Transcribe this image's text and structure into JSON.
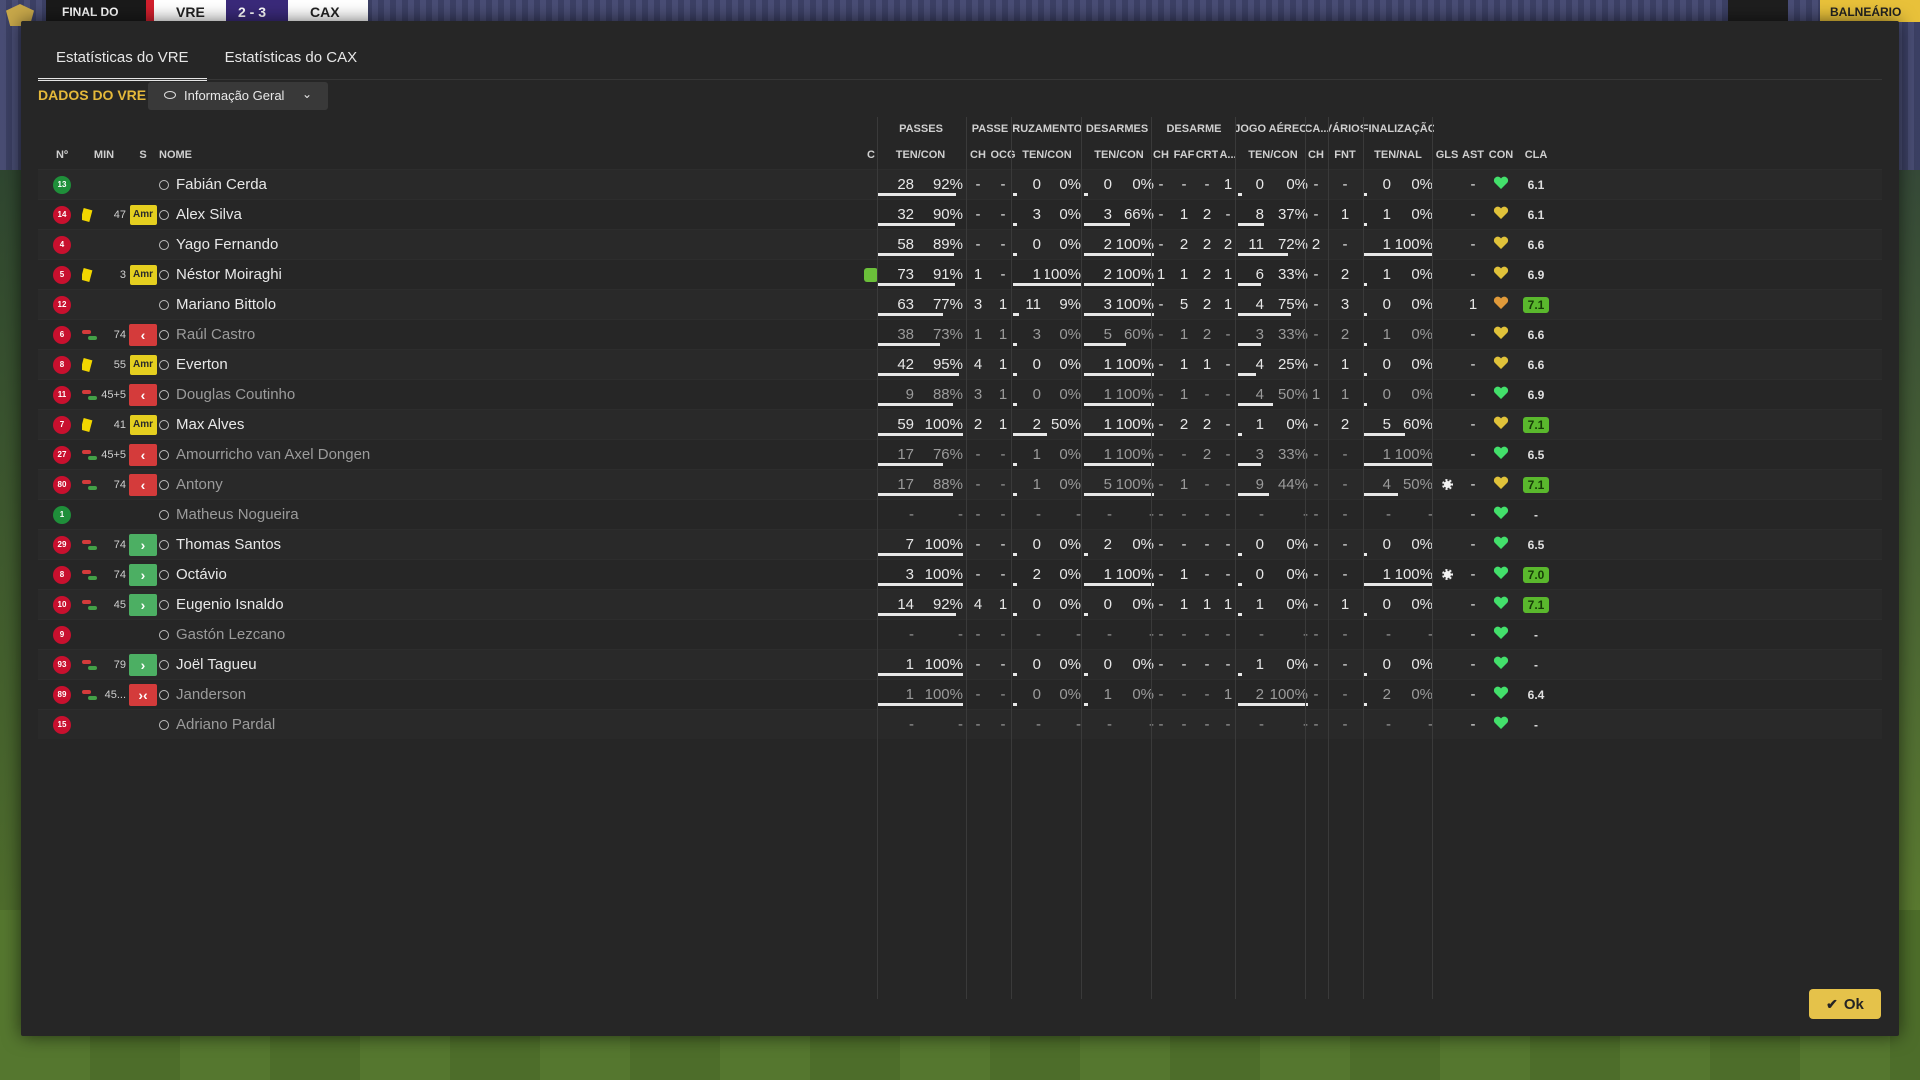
{
  "topbar": {
    "final_label": "FINAL DO",
    "home_team": "VRE",
    "score": "2 - 3",
    "away_team": "CAX",
    "balneario_label": "BALNEÁRIO"
  },
  "tabs": [
    {
      "label": "Estatísticas do VRE",
      "active": true
    },
    {
      "label": "Estatísticas do CAX",
      "active": false
    }
  ],
  "section_title": "DADOS DO VRE",
  "view_select": {
    "value": "Informação Geral"
  },
  "group_headers": {
    "passes": "PASSES",
    "passe": "PASSE",
    "cruzamentos": "CRUZAMENTOS",
    "desarmes": "DESARMES",
    "desarme": "DESARME",
    "jogo_aereo": "JOGO AÉREO",
    "ca": "CA...",
    "varios": "VÁRIOS",
    "finalizacao": "FINALIZAÇÃO"
  },
  "columns": {
    "no": "Nº",
    "min": "MIN",
    "s": "S",
    "nome": "NOME",
    "c": "C",
    "passes": "TEN/CON",
    "passe_ch": "CH",
    "passe_ocg": "OCG",
    "cruz": "TEN/CON",
    "desarmes": "TEN/CON",
    "des_ch": "CH",
    "des_faf": "FAF",
    "des_crt": "CRT",
    "des_a": "A...",
    "aereo": "TEN/CON",
    "ca_ch": "CH",
    "fnt": "FNT",
    "final": "TEN/NAL",
    "gls": "GLS",
    "ast": "AST",
    "con": "CON",
    "cla": "CLA"
  },
  "rows": [
    {
      "no": "13",
      "gk": true,
      "card": false,
      "sub": false,
      "min": "",
      "badge": "",
      "name": "Fabián Cerda",
      "dim": false,
      "c": "",
      "pas": [
        "28",
        "92%"
      ],
      "pch": "-",
      "pocg": "-",
      "cru": [
        "0",
        "0%"
      ],
      "des": [
        "0",
        "0%"
      ],
      "dch": "-",
      "dfaf": "-",
      "dcrt": "-",
      "da": "1",
      "aer": [
        "0",
        "0%"
      ],
      "cach": "-",
      "fnt": "-",
      "fin": [
        "0",
        "0%"
      ],
      "gls": "",
      "ast": "-",
      "con": "green",
      "cla": "6.1",
      "cla_good": false
    },
    {
      "no": "14",
      "gk": false,
      "card": true,
      "sub": false,
      "min": "47",
      "badge": "Amr",
      "name": "Alex Silva",
      "dim": false,
      "c": "",
      "pas": [
        "32",
        "90%"
      ],
      "pch": "-",
      "pocg": "-",
      "cru": [
        "3",
        "0%"
      ],
      "des": [
        "3",
        "66%"
      ],
      "dch": "-",
      "dfaf": "1",
      "dcrt": "2",
      "da": "-",
      "aer": [
        "8",
        "37%"
      ],
      "cach": "-",
      "fnt": "1",
      "fin": [
        "1",
        "0%"
      ],
      "gls": "",
      "ast": "-",
      "con": "yellow",
      "cla": "6.1",
      "cla_good": false
    },
    {
      "no": "4",
      "gk": false,
      "card": false,
      "sub": false,
      "min": "",
      "badge": "",
      "name": "Yago Fernando",
      "dim": false,
      "c": "",
      "pas": [
        "58",
        "89%"
      ],
      "pch": "-",
      "pocg": "-",
      "cru": [
        "0",
        "0%"
      ],
      "des": [
        "2",
        "100%"
      ],
      "dch": "-",
      "dfaf": "2",
      "dcrt": "2",
      "da": "2",
      "aer": [
        "11",
        "72%"
      ],
      "cach": "2",
      "fnt": "-",
      "fin": [
        "1",
        "100%"
      ],
      "gls": "",
      "ast": "-",
      "con": "yellow",
      "cla": "6.6",
      "cla_good": false
    },
    {
      "no": "5",
      "gk": false,
      "card": true,
      "sub": false,
      "min": "3",
      "badge": "Amr",
      "name": "Néstor Moiraghi",
      "dim": false,
      "c": "bottle",
      "pas": [
        "73",
        "91%"
      ],
      "pch": "1",
      "pocg": "-",
      "cru": [
        "1",
        "100%"
      ],
      "des": [
        "2",
        "100%"
      ],
      "dch": "1",
      "dfaf": "1",
      "dcrt": "2",
      "da": "1",
      "aer": [
        "6",
        "33%"
      ],
      "cach": "-",
      "fnt": "2",
      "fin": [
        "1",
        "0%"
      ],
      "gls": "",
      "ast": "-",
      "con": "yellow",
      "cla": "6.9",
      "cla_good": false
    },
    {
      "no": "12",
      "gk": false,
      "card": false,
      "sub": false,
      "min": "",
      "badge": "",
      "name": "Mariano Bittolo",
      "dim": false,
      "c": "",
      "pas": [
        "63",
        "77%"
      ],
      "pch": "3",
      "pocg": "1",
      "cru": [
        "11",
        "9%"
      ],
      "des": [
        "3",
        "100%"
      ],
      "dch": "-",
      "dfaf": "5",
      "dcrt": "2",
      "da": "1",
      "aer": [
        "4",
        "75%"
      ],
      "cach": "-",
      "fnt": "3",
      "fin": [
        "0",
        "0%"
      ],
      "gls": "",
      "ast": "1",
      "con": "orange",
      "cla": "7.1",
      "cla_good": true
    },
    {
      "no": "6",
      "gk": false,
      "card": false,
      "sub": true,
      "min": "74",
      "badge": "out",
      "name": "Raúl Castro",
      "dim": true,
      "c": "",
      "pas": [
        "38",
        "73%"
      ],
      "pch": "1",
      "pocg": "1",
      "cru": [
        "3",
        "0%"
      ],
      "des": [
        "5",
        "60%"
      ],
      "dch": "-",
      "dfaf": "1",
      "dcrt": "2",
      "da": "-",
      "aer": [
        "3",
        "33%"
      ],
      "cach": "-",
      "fnt": "2",
      "fin": [
        "1",
        "0%"
      ],
      "gls": "",
      "ast": "-",
      "con": "yellow",
      "cla": "6.6",
      "cla_good": false
    },
    {
      "no": "8",
      "gk": false,
      "card": true,
      "sub": false,
      "min": "55",
      "badge": "Amr",
      "name": "Everton",
      "dim": false,
      "c": "",
      "pas": [
        "42",
        "95%"
      ],
      "pch": "4",
      "pocg": "1",
      "cru": [
        "0",
        "0%"
      ],
      "des": [
        "1",
        "100%"
      ],
      "dch": "-",
      "dfaf": "1",
      "dcrt": "1",
      "da": "-",
      "aer": [
        "4",
        "25%"
      ],
      "cach": "-",
      "fnt": "1",
      "fin": [
        "0",
        "0%"
      ],
      "gls": "",
      "ast": "-",
      "con": "yellow",
      "cla": "6.6",
      "cla_good": false
    },
    {
      "no": "11",
      "gk": false,
      "card": false,
      "sub": true,
      "min": "45+5",
      "badge": "out",
      "name": "Douglas Coutinho",
      "dim": true,
      "c": "",
      "pas": [
        "9",
        "88%"
      ],
      "pch": "3",
      "pocg": "1",
      "cru": [
        "0",
        "0%"
      ],
      "des": [
        "1",
        "100%"
      ],
      "dch": "-",
      "dfaf": "1",
      "dcrt": "-",
      "da": "-",
      "aer": [
        "4",
        "50%"
      ],
      "cach": "1",
      "fnt": "1",
      "fin": [
        "0",
        "0%"
      ],
      "gls": "",
      "ast": "-",
      "con": "green",
      "cla": "6.9",
      "cla_good": false
    },
    {
      "no": "7",
      "gk": false,
      "card": true,
      "sub": false,
      "min": "41",
      "badge": "Amr",
      "name": "Max Alves",
      "dim": false,
      "c": "",
      "pas": [
        "59",
        "100%"
      ],
      "pch": "2",
      "pocg": "1",
      "cru": [
        "2",
        "50%"
      ],
      "des": [
        "1",
        "100%"
      ],
      "dch": "-",
      "dfaf": "2",
      "dcrt": "2",
      "da": "-",
      "aer": [
        "1",
        "0%"
      ],
      "cach": "-",
      "fnt": "2",
      "fin": [
        "5",
        "60%"
      ],
      "gls": "",
      "ast": "-",
      "con": "yellow",
      "cla": "7.1",
      "cla_good": true
    },
    {
      "no": "27",
      "gk": false,
      "card": false,
      "sub": true,
      "min": "45+5",
      "badge": "out",
      "name": "Amourricho van Axel Dongen",
      "dim": true,
      "c": "",
      "pas": [
        "17",
        "76%"
      ],
      "pch": "-",
      "pocg": "-",
      "cru": [
        "1",
        "0%"
      ],
      "des": [
        "1",
        "100%"
      ],
      "dch": "-",
      "dfaf": "-",
      "dcrt": "2",
      "da": "-",
      "aer": [
        "3",
        "33%"
      ],
      "cach": "-",
      "fnt": "-",
      "fin": [
        "1",
        "100%"
      ],
      "gls": "",
      "ast": "-",
      "con": "green",
      "cla": "6.5",
      "cla_good": false
    },
    {
      "no": "80",
      "gk": false,
      "card": false,
      "sub": true,
      "min": "74",
      "badge": "out",
      "name": "Antony",
      "dim": true,
      "c": "",
      "pas": [
        "17",
        "88%"
      ],
      "pch": "-",
      "pocg": "-",
      "cru": [
        "1",
        "0%"
      ],
      "des": [
        "5",
        "100%"
      ],
      "dch": "-",
      "dfaf": "1",
      "dcrt": "-",
      "da": "-",
      "aer": [
        "9",
        "44%"
      ],
      "cach": "-",
      "fnt": "-",
      "fin": [
        "4",
        "50%"
      ],
      "gls": "ball",
      "ast": "-",
      "con": "yellow",
      "cla": "7.1",
      "cla_good": true
    },
    {
      "no": "1",
      "gk": true,
      "card": false,
      "sub": false,
      "min": "",
      "badge": "",
      "name": "Matheus Nogueira",
      "dim": true,
      "c": "",
      "pas": [
        "-",
        "-"
      ],
      "pch": "-",
      "pocg": "-",
      "cru": [
        "-",
        "-"
      ],
      "des": [
        "-",
        "-"
      ],
      "dch": "-",
      "dfaf": "-",
      "dcrt": "-",
      "da": "-",
      "aer": [
        "-",
        "-"
      ],
      "cach": "-",
      "fnt": "-",
      "fin": [
        "-",
        "-"
      ],
      "gls": "",
      "ast": "-",
      "con": "green",
      "cla": "-",
      "cla_good": false
    },
    {
      "no": "29",
      "gk": false,
      "card": false,
      "sub": true,
      "min": "74",
      "badge": "in",
      "name": "Thomas Santos",
      "dim": false,
      "c": "",
      "pas": [
        "7",
        "100%"
      ],
      "pch": "-",
      "pocg": "-",
      "cru": [
        "0",
        "0%"
      ],
      "des": [
        "2",
        "0%"
      ],
      "dch": "-",
      "dfaf": "-",
      "dcrt": "-",
      "da": "-",
      "aer": [
        "0",
        "0%"
      ],
      "cach": "-",
      "fnt": "-",
      "fin": [
        "0",
        "0%"
      ],
      "gls": "",
      "ast": "-",
      "con": "green",
      "cla": "6.5",
      "cla_good": false
    },
    {
      "no": "8",
      "gk": false,
      "card": false,
      "sub": true,
      "min": "74",
      "badge": "in",
      "name": "Octávio",
      "dim": false,
      "c": "",
      "pas": [
        "3",
        "100%"
      ],
      "pch": "-",
      "pocg": "-",
      "cru": [
        "2",
        "0%"
      ],
      "des": [
        "1",
        "100%"
      ],
      "dch": "-",
      "dfaf": "1",
      "dcrt": "-",
      "da": "-",
      "aer": [
        "0",
        "0%"
      ],
      "cach": "-",
      "fnt": "-",
      "fin": [
        "1",
        "100%"
      ],
      "gls": "ball",
      "ast": "-",
      "con": "green",
      "cla": "7.0",
      "cla_good": true
    },
    {
      "no": "10",
      "gk": false,
      "card": false,
      "sub": true,
      "min": "45",
      "badge": "in",
      "name": "Eugenio Isnaldo",
      "dim": false,
      "c": "",
      "pas": [
        "14",
        "92%"
      ],
      "pch": "4",
      "pocg": "1",
      "cru": [
        "0",
        "0%"
      ],
      "des": [
        "0",
        "0%"
      ],
      "dch": "-",
      "dfaf": "1",
      "dcrt": "1",
      "da": "1",
      "aer": [
        "1",
        "0%"
      ],
      "cach": "-",
      "fnt": "1",
      "fin": [
        "0",
        "0%"
      ],
      "gls": "",
      "ast": "-",
      "con": "green",
      "cla": "7.1",
      "cla_good": true
    },
    {
      "no": "9",
      "gk": false,
      "card": false,
      "sub": false,
      "min": "",
      "badge": "",
      "name": "Gastón Lezcano",
      "dim": true,
      "c": "",
      "pas": [
        "-",
        "-"
      ],
      "pch": "-",
      "pocg": "-",
      "cru": [
        "-",
        "-"
      ],
      "des": [
        "-",
        "-"
      ],
      "dch": "-",
      "dfaf": "-",
      "dcrt": "-",
      "da": "-",
      "aer": [
        "-",
        "-"
      ],
      "cach": "-",
      "fnt": "-",
      "fin": [
        "-",
        "-"
      ],
      "gls": "",
      "ast": "-",
      "con": "green",
      "cla": "-",
      "cla_good": false
    },
    {
      "no": "93",
      "gk": false,
      "card": false,
      "sub": true,
      "min": "79",
      "badge": "in",
      "name": "Joël Tagueu",
      "dim": false,
      "c": "",
      "pas": [
        "1",
        "100%"
      ],
      "pch": "-",
      "pocg": "-",
      "cru": [
        "0",
        "0%"
      ],
      "des": [
        "0",
        "0%"
      ],
      "dch": "-",
      "dfaf": "-",
      "dcrt": "-",
      "da": "-",
      "aer": [
        "1",
        "0%"
      ],
      "cach": "-",
      "fnt": "-",
      "fin": [
        "0",
        "0%"
      ],
      "gls": "",
      "ast": "-",
      "con": "green",
      "cla": "-",
      "cla_good": false
    },
    {
      "no": "89",
      "gk": false,
      "card": false,
      "sub": true,
      "min": "45...",
      "badge": "inout",
      "name": "Janderson",
      "dim": true,
      "c": "",
      "pas": [
        "1",
        "100%"
      ],
      "pch": "-",
      "pocg": "-",
      "cru": [
        "0",
        "0%"
      ],
      "des": [
        "1",
        "0%"
      ],
      "dch": "-",
      "dfaf": "-",
      "dcrt": "-",
      "da": "1",
      "aer": [
        "2",
        "100%"
      ],
      "cach": "-",
      "fnt": "-",
      "fin": [
        "2",
        "0%"
      ],
      "gls": "",
      "ast": "-",
      "con": "green",
      "cla": "6.4",
      "cla_good": false
    },
    {
      "no": "15",
      "gk": false,
      "card": false,
      "sub": false,
      "min": "",
      "badge": "",
      "name": "Adriano Pardal",
      "dim": true,
      "c": "",
      "pas": [
        "-",
        "-"
      ],
      "pch": "-",
      "pocg": "-",
      "cru": [
        "-",
        "-"
      ],
      "des": [
        "-",
        "-"
      ],
      "dch": "-",
      "dfaf": "-",
      "dcrt": "-",
      "da": "-",
      "aer": [
        "-",
        "-"
      ],
      "cach": "-",
      "fnt": "-",
      "fin": [
        "-",
        "-"
      ],
      "gls": "",
      "ast": "-",
      "con": "green",
      "cla": "-",
      "cla_good": false
    }
  ],
  "ok_button": {
    "label": "Ok"
  },
  "colors": {
    "accent": "#e5b93a",
    "card": "#f2d600",
    "sub_out": "#d43b3b",
    "sub_in": "#4caf63",
    "rating_good": "#5ab82d"
  }
}
